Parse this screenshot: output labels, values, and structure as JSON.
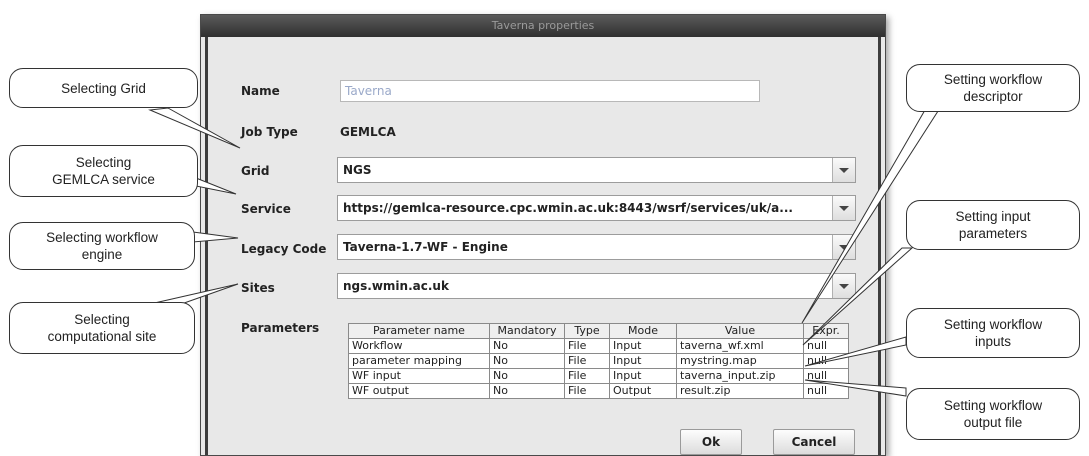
{
  "dialog": {
    "title": "Taverna properties",
    "fields": {
      "name_label": "Name",
      "name_value": "Taverna",
      "jobtype_label": "Job Type",
      "jobtype_value": "GEMLCA",
      "grid_label": "Grid",
      "grid_value": "NGS",
      "service_label": "Service",
      "service_value": "https://gemlca-resource.cpc.wmin.ac.uk:8443/wsrf/services/uk/a...",
      "legacy_label": "Legacy Code",
      "legacy_value": "Taverna-1.7-WF - Engine",
      "sites_label": "Sites",
      "sites_value": "ngs.wmin.ac.uk",
      "params_label": "Parameters"
    },
    "table": {
      "headers": [
        "Parameter name",
        "Mandatory",
        "Type",
        "Mode",
        "Value",
        "Expr."
      ],
      "rows": [
        [
          "Workflow",
          "No",
          "File",
          "Input",
          "taverna_wf.xml",
          "null"
        ],
        [
          "parameter mapping",
          "No",
          "File",
          "Input",
          "mystring.map",
          "null"
        ],
        [
          "WF input",
          "No",
          "File",
          "Input",
          "taverna_input.zip",
          "null"
        ],
        [
          "WF output",
          "No",
          "File",
          "Output",
          "result.zip",
          "null"
        ]
      ]
    },
    "buttons": {
      "ok": "Ok",
      "cancel": "Cancel"
    }
  },
  "callouts": {
    "grid": "Selecting Grid",
    "service_1": "Selecting",
    "service_2": "GEMLCA service",
    "engine_1": "Selecting workflow",
    "engine_2": "engine",
    "site_1": "Selecting",
    "site_2": "computational site",
    "descriptor_1": "Setting workflow",
    "descriptor_2": "descriptor",
    "inputparams_1": "Setting input",
    "inputparams_2": "parameters",
    "inputs_1": "Setting workflow",
    "inputs_2": "inputs",
    "output_1": "Setting workflow",
    "output_2": "output file"
  }
}
